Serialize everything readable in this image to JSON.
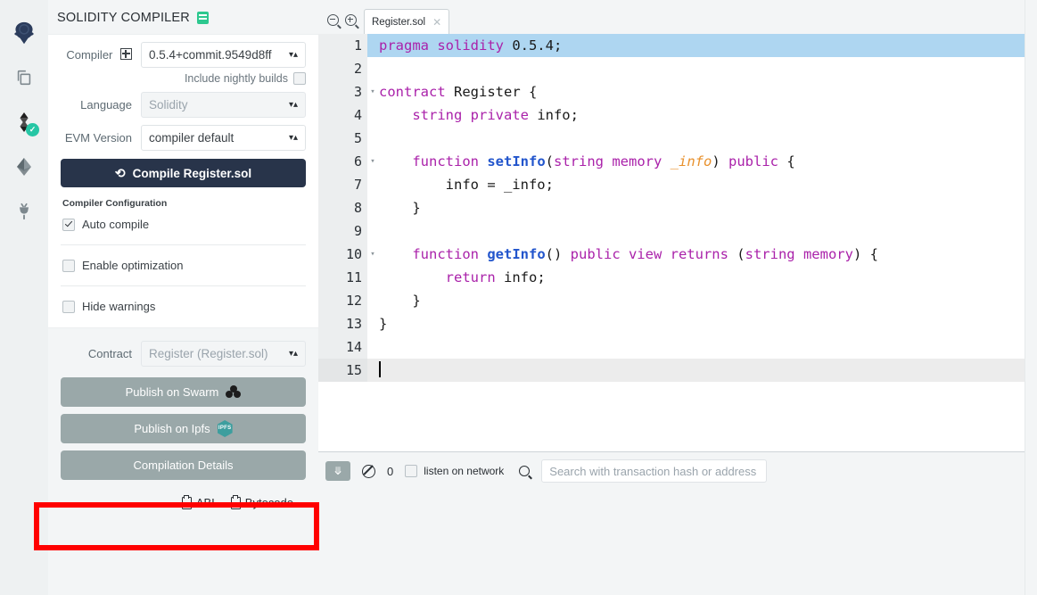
{
  "iconbar": {
    "items": [
      {
        "name": "remix-home-icon",
        "title": "Remix Home"
      },
      {
        "name": "file-explorers-icon",
        "title": "File explorers"
      },
      {
        "name": "solidity-compiler-icon",
        "title": "Solidity compiler",
        "badge": "✓"
      },
      {
        "name": "deploy-run-icon",
        "title": "Deploy & run transactions"
      },
      {
        "name": "plugin-manager-icon",
        "title": "Plugin manager"
      }
    ]
  },
  "panel": {
    "title": "SOLIDITY COMPILER",
    "doc_icon": "book-icon",
    "compiler": {
      "label": "Compiler",
      "expand_icon": "plus-square-icon",
      "value": "0.5.4+commit.9549d8ff",
      "nightly_label": "Include nightly builds",
      "nightly_checked": false
    },
    "language": {
      "label": "Language",
      "value": "Solidity"
    },
    "evm": {
      "label": "EVM Version",
      "value": "compiler default"
    },
    "compile_button": "Compile Register.sol",
    "config_title": "Compiler Configuration",
    "checkboxes": [
      {
        "label": "Auto compile",
        "checked": true
      },
      {
        "label": "Enable optimization",
        "checked": false
      },
      {
        "label": "Hide warnings",
        "checked": false
      }
    ],
    "contract": {
      "label": "Contract",
      "value": "Register (Register.sol)"
    },
    "publish_buttons": [
      {
        "label": "Publish on Swarm",
        "icon": "swarm-icon"
      },
      {
        "label": "Publish on Ipfs",
        "icon": "ipfs-icon"
      },
      {
        "label": "Compilation Details",
        "icon": "none",
        "highlighted": true
      }
    ],
    "copy_items": [
      {
        "label": "ABI",
        "icon": "clipboard-icon"
      },
      {
        "label": "Bytecode",
        "icon": "clipboard-icon"
      }
    ]
  },
  "editor": {
    "zoom_out_icon": "zoom-out-icon",
    "zoom_in_icon": "zoom-in-icon",
    "tab": {
      "label": "Register.sol",
      "close": "✕"
    },
    "lines": [
      {
        "n": "1",
        "fold": "",
        "state": "selected",
        "tokens": [
          {
            "t": "pragma solidity ",
            "c": "kw"
          },
          {
            "t": "0.5.4",
            "c": "num"
          },
          {
            "t": ";",
            "c": "plain"
          }
        ]
      },
      {
        "n": "2",
        "fold": "",
        "state": "",
        "tokens": []
      },
      {
        "n": "3",
        "fold": "▾",
        "state": "",
        "tokens": [
          {
            "t": "contract ",
            "c": "kw"
          },
          {
            "t": "Register {",
            "c": "plain"
          }
        ]
      },
      {
        "n": "4",
        "fold": "",
        "state": "",
        "tokens": [
          {
            "t": "    ",
            "c": "plain"
          },
          {
            "t": "string private ",
            "c": "kw"
          },
          {
            "t": "info;",
            "c": "plain"
          }
        ]
      },
      {
        "n": "5",
        "fold": "",
        "state": "",
        "tokens": []
      },
      {
        "n": "6",
        "fold": "▾",
        "state": "",
        "tokens": [
          {
            "t": "    ",
            "c": "plain"
          },
          {
            "t": "function ",
            "c": "kw"
          },
          {
            "t": "setInfo",
            "c": "fn"
          },
          {
            "t": "(",
            "c": "plain"
          },
          {
            "t": "string memory ",
            "c": "kw"
          },
          {
            "t": "_info",
            "c": "param"
          },
          {
            "t": ") ",
            "c": "plain"
          },
          {
            "t": "public",
            "c": "kw"
          },
          {
            "t": " {",
            "c": "plain"
          }
        ]
      },
      {
        "n": "7",
        "fold": "",
        "state": "",
        "tokens": [
          {
            "t": "        info = _info;",
            "c": "plain"
          }
        ]
      },
      {
        "n": "8",
        "fold": "",
        "state": "",
        "tokens": [
          {
            "t": "    }",
            "c": "plain"
          }
        ]
      },
      {
        "n": "9",
        "fold": "",
        "state": "",
        "tokens": []
      },
      {
        "n": "10",
        "fold": "▾",
        "state": "",
        "tokens": [
          {
            "t": "    ",
            "c": "plain"
          },
          {
            "t": "function ",
            "c": "kw"
          },
          {
            "t": "getInfo",
            "c": "fn"
          },
          {
            "t": "() ",
            "c": "plain"
          },
          {
            "t": "public view returns ",
            "c": "kw"
          },
          {
            "t": "(",
            "c": "plain"
          },
          {
            "t": "string memory",
            "c": "kw"
          },
          {
            "t": ") {",
            "c": "plain"
          }
        ]
      },
      {
        "n": "11",
        "fold": "",
        "state": "",
        "tokens": [
          {
            "t": "        ",
            "c": "plain"
          },
          {
            "t": "return",
            "c": "kw"
          },
          {
            "t": " info;",
            "c": "plain"
          }
        ]
      },
      {
        "n": "12",
        "fold": "",
        "state": "",
        "tokens": [
          {
            "t": "    }",
            "c": "plain"
          }
        ]
      },
      {
        "n": "13",
        "fold": "",
        "state": "",
        "tokens": [
          {
            "t": "}",
            "c": "plain"
          }
        ]
      },
      {
        "n": "14",
        "fold": "",
        "state": "",
        "tokens": []
      },
      {
        "n": "15",
        "fold": "",
        "state": "active",
        "tokens": [],
        "caret": true
      }
    ]
  },
  "terminal": {
    "toggle_icon": "chevrons-down-icon",
    "clear_icon": "ban-icon",
    "pending_count": "0",
    "listen_label": "listen on network",
    "listen_checked": false,
    "search_icon": "search-icon",
    "search_placeholder": "Search with transaction hash or address",
    "search_value": ""
  },
  "colors": {
    "accent_dark": "#28344a",
    "button_gray": "#9aa8a9",
    "keyword": "#aa22aa",
    "function": "#2255cc",
    "param": "#e8912d",
    "highlight_red": "#ff0000",
    "selection_blue": "#aed6f1",
    "badge_green": "#26c6a5"
  }
}
